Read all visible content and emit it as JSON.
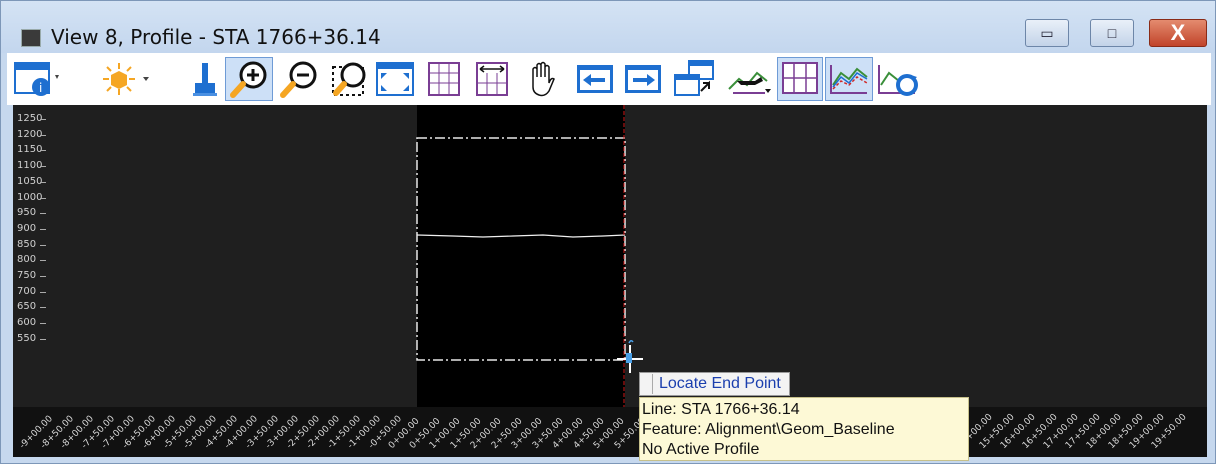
{
  "window": {
    "title": "View 8, Profile - STA 1766+36.14",
    "minimize_glyph": "▭",
    "maximize_glyph": "□",
    "close_glyph": "X"
  },
  "toolbar": {
    "items": [
      {
        "name": "view-attributes-icon",
        "active": false
      },
      {
        "name": "display-style-icon",
        "active": false
      },
      {
        "name": "update-view-brush-icon",
        "active": false
      },
      {
        "name": "zoom-in-icon",
        "active": true
      },
      {
        "name": "zoom-out-icon",
        "active": false
      },
      {
        "name": "window-area-icon",
        "active": false
      },
      {
        "name": "fit-view-icon",
        "active": false
      },
      {
        "name": "vertical-exaggeration-icon",
        "active": false
      },
      {
        "name": "horizontal-scale-icon",
        "active": false
      },
      {
        "name": "pan-hand-icon",
        "active": false
      },
      {
        "name": "previous-view-icon",
        "active": false
      },
      {
        "name": "next-view-icon",
        "active": false
      },
      {
        "name": "copy-view-icon",
        "active": false
      },
      {
        "name": "profile-flyover-icon",
        "active": false
      },
      {
        "name": "grid-toggle-icon",
        "active": true
      },
      {
        "name": "profile-display-icon",
        "active": true
      },
      {
        "name": "refresh-profile-icon",
        "active": false
      }
    ]
  },
  "y_axis": {
    "ticks": [
      "1250",
      "1200",
      "1150",
      "1100",
      "1050",
      "1000",
      "950",
      "900",
      "850",
      "800",
      "750",
      "700",
      "650",
      "600",
      "550"
    ]
  },
  "x_axis": {
    "ticks": [
      "-9+00.00",
      "-8+50.00",
      "-8+00.00",
      "-7+50.00",
      "-7+00.00",
      "-6+50.00",
      "-6+00.00",
      "-5+50.00",
      "-5+00.00",
      "-4+50.00",
      "-4+00.00",
      "-3+50.00",
      "-3+00.00",
      "-2+50.00",
      "-2+00.00",
      "-1+50.00",
      "-1+00.00",
      "-0+50.00",
      "0+00.00",
      "0+50.00",
      "1+00.00",
      "1+50.00",
      "2+00.00",
      "2+50.00",
      "3+00.00",
      "3+50.00",
      "4+00.00",
      "4+50.00",
      "5+00.00",
      "5+50.00",
      "15+00.00",
      "15+50.00",
      "16+00.00",
      "16+50.00",
      "17+00.00",
      "17+50.00",
      "18+00.00",
      "18+50.00",
      "19+00.00",
      "19+50.00"
    ]
  },
  "prompt": {
    "label": "Locate End Point"
  },
  "tooltip": {
    "line1": "Line: STA 1766+36.14",
    "line2": "Feature:  Alignment\\Geom_Baseline",
    "line3": "No Active Profile"
  },
  "colors": {
    "accent": "#cde0f7",
    "close_red": "#c1442a",
    "cursor_red": "#d01818"
  }
}
